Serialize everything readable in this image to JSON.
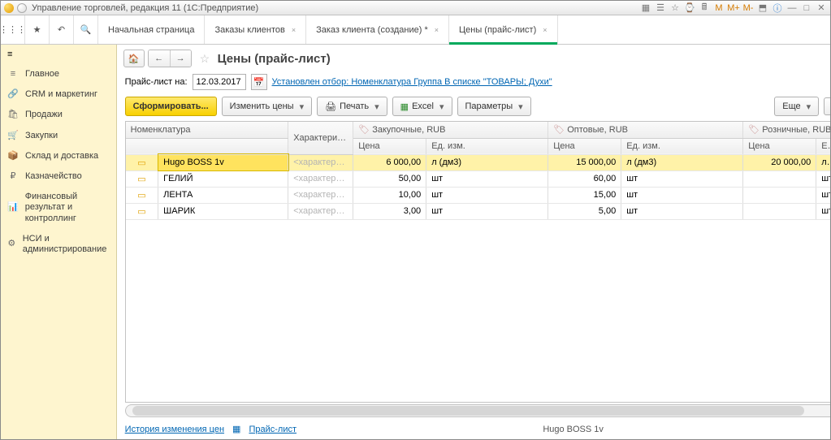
{
  "title": "Управление торговлей, редакция 11  (1С:Предприятие)",
  "tabs": [
    "Начальная страница",
    "Заказы клиентов",
    "Заказ клиента (создание) *",
    "Цены (прайс-лист)"
  ],
  "activeTab": 3,
  "sidebar": {
    "items": [
      {
        "icon": "≡",
        "label": "Главное"
      },
      {
        "icon": "🔗",
        "label": "CRM и маркетинг"
      },
      {
        "icon": "🛍",
        "label": "Продажи"
      },
      {
        "icon": "🛒",
        "label": "Закупки"
      },
      {
        "icon": "📦",
        "label": "Склад и доставка"
      },
      {
        "icon": "₽",
        "label": "Казначейство"
      },
      {
        "icon": "📊",
        "label": "Финансовый результат и контроллинг"
      },
      {
        "icon": "⚙",
        "label": "НСИ и администрирование"
      }
    ]
  },
  "page": {
    "title": "Цены (прайс-лист)",
    "dateLabel": "Прайс-лист на:",
    "date": "12.03.2017",
    "filterLink": "Установлен отбор: Номенклатура Группа В списке \"ТОВАРЫ; Духи\""
  },
  "toolbar": {
    "form": "Сформировать...",
    "change": "Изменить цены",
    "print": "Печать",
    "excel": "Excel",
    "params": "Параметры",
    "more": "Еще"
  },
  "grid": {
    "headers": {
      "nomen": "Номенклатура",
      "char": "Характеристика",
      "g1": "Закупочные, RUB",
      "g2": "Оптовые, RUB",
      "g3": "Розничные, RUB",
      "price": "Цена",
      "unit": "Ед. изм."
    },
    "rows": [
      {
        "name": "Hugo BOSS 1v",
        "char": "<характерист...",
        "p1": "6 000,00",
        "u1": "л (дм3)",
        "p2": "15 000,00",
        "u2": "л (дм3)",
        "p3": "20 000,00",
        "u3": "л (дм"
      },
      {
        "name": "ГЕЛИЙ",
        "char": "<характерист...",
        "p1": "50,00",
        "u1": "шт",
        "p2": "60,00",
        "u2": "шт",
        "p3": "",
        "u3": "шт"
      },
      {
        "name": "ЛЕНТА",
        "char": "<характерист...",
        "p1": "10,00",
        "u1": "шт",
        "p2": "15,00",
        "u2": "шт",
        "p3": "",
        "u3": "шт"
      },
      {
        "name": "ШАРИК",
        "char": "<характерист...",
        "p1": "3,00",
        "u1": "шт",
        "p2": "5,00",
        "u2": "шт",
        "p3": "",
        "u3": "шт"
      }
    ]
  },
  "status": {
    "history": "История изменения цен",
    "pricelist": "Прайс-лист",
    "current": "Hugo BOSS 1v"
  }
}
